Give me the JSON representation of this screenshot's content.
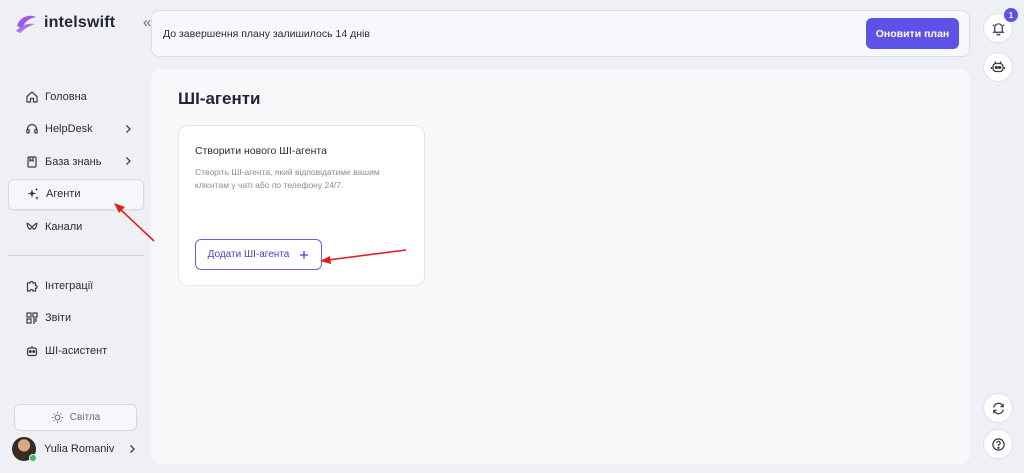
{
  "brand": {
    "name": "intelswift",
    "accent": "#5d52e6"
  },
  "sidebar": {
    "collapse_icon": "double-chevron-left-icon",
    "items": [
      {
        "label": "Головна",
        "icon": "home-icon"
      },
      {
        "label": "HelpDesk",
        "icon": "headset-icon",
        "has_submenu": true
      },
      {
        "label": "База знань",
        "icon": "book-icon",
        "has_submenu": true
      },
      {
        "label": "Агенти",
        "icon": "sparkles-icon",
        "active": true
      },
      {
        "label": "Канали",
        "icon": "channels-icon"
      }
    ],
    "secondary_items": [
      {
        "label": "Інтеграції",
        "icon": "puzzle-icon"
      },
      {
        "label": "Звіти",
        "icon": "reports-icon"
      },
      {
        "label": "ШІ-асистент",
        "icon": "robot-icon"
      }
    ],
    "theme_label": "Світла",
    "user_name": "Yulia Romaniv"
  },
  "topbar": {
    "trial_text": "До завершення плану залишилось 14 днів",
    "upgrade_label": "Оновити план"
  },
  "rightbar": {
    "notifications_count": "1"
  },
  "main": {
    "title": "ШІ-агенти",
    "card": {
      "title": "Створити нового ШІ-агента",
      "description": "Створіть ШІ-агента, який відповідатиме вашим клієнтам у чаті або по телефону 24/7.",
      "button_label": "Додати ШІ-агента"
    }
  }
}
